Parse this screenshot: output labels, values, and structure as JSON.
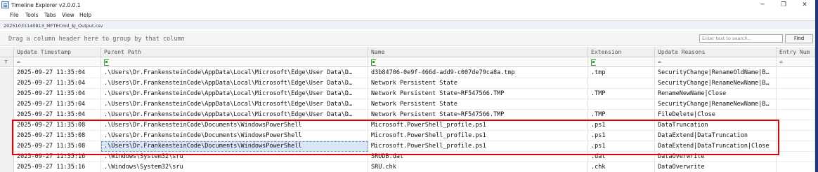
{
  "window": {
    "title": "Timeline Explorer v2.0.0.1",
    "minimize": "─",
    "maximize": "❐",
    "close": "✕"
  },
  "menu": [
    "File",
    "Tools",
    "Tabs",
    "View",
    "Help"
  ],
  "file_tab": "20251031140813_MFTECmd_$J_Output.csv",
  "group_hint": "Drag a column header here to group by that column",
  "search": {
    "placeholder": "Enter text to search...",
    "value": ""
  },
  "find_label": "Find",
  "columns": [
    "Update Timestamp",
    "Parent Path",
    "Name",
    "Extension",
    "Update Reasons",
    "Entry Num"
  ],
  "filter_row": {
    "marker": "⊤",
    "equals": "="
  },
  "rows": [
    [
      "2025-09-27 11:35:04",
      ".\\Users\\Dr.FrankensteinCode\\AppData\\Local\\Microsoft\\Edge\\User Data\\D…",
      "d3b84706-0e9f-466d-add9-c007de79ca8a.tmp",
      ".tmp",
      "SecurityChange|RenameOldName|B…",
      ""
    ],
    [
      "2025-09-27 11:35:04",
      ".\\Users\\Dr.FrankensteinCode\\AppData\\Local\\Microsoft\\Edge\\User Data\\D…",
      "Network Persistent State",
      "",
      "SecurityChange|RenameNewName|B…",
      ""
    ],
    [
      "2025-09-27 11:35:04",
      ".\\Users\\Dr.FrankensteinCode\\AppData\\Local\\Microsoft\\Edge\\User Data\\D…",
      "Network Persistent State~RF547566.TMP",
      ".TMP",
      "RenameNewName|Close",
      ""
    ],
    [
      "2025-09-27 11:35:04",
      ".\\Users\\Dr.FrankensteinCode\\AppData\\Local\\Microsoft\\Edge\\User Data\\D…",
      "Network Persistent State",
      "",
      "SecurityChange|RenameNewName|B…",
      ""
    ],
    [
      "2025-09-27 11:35:04",
      ".\\Users\\Dr.FrankensteinCode\\AppData\\Local\\Microsoft\\Edge\\User Data\\D…",
      "Network Persistent State~RF547566.TMP",
      ".TMP",
      "FileDelete|Close",
      ""
    ],
    [
      "2025-09-27 11:35:08",
      ".\\Users\\Dr.FrankensteinCode\\Documents\\WindowsPowerShell",
      "Microsoft.PowerShell_profile.ps1",
      ".ps1",
      "DataTruncation",
      ""
    ],
    [
      "2025-09-27 11:35:08",
      ".\\Users\\Dr.FrankensteinCode\\Documents\\WindowsPowerShell",
      "Microsoft.PowerShell_profile.ps1",
      ".ps1",
      "DataExtend|DataTruncation",
      ""
    ],
    [
      "2025-09-27 11:35:08",
      ".\\Users\\Dr.FrankensteinCode\\Documents\\WindowsPowerShell",
      "Microsoft.PowerShell_profile.ps1",
      ".ps1",
      "DataExtend|DataTruncation|Close",
      ""
    ],
    [
      "2025-09-27 11:35:16",
      ".\\Windows\\System32\\sru",
      "SRUDB.dat",
      ".dat",
      "DataOverwrite",
      ""
    ],
    [
      "2025-09-27 11:35:16",
      ".\\Windows\\System32\\sru",
      "SRU.chk",
      ".chk",
      "DataOverwrite",
      ""
    ]
  ],
  "selected_cell": {
    "row": 7,
    "col": 1
  },
  "colors": {
    "highlight": "#e00000",
    "selection": "#d8e7f7",
    "filter_icon": "#2e9e3a"
  }
}
